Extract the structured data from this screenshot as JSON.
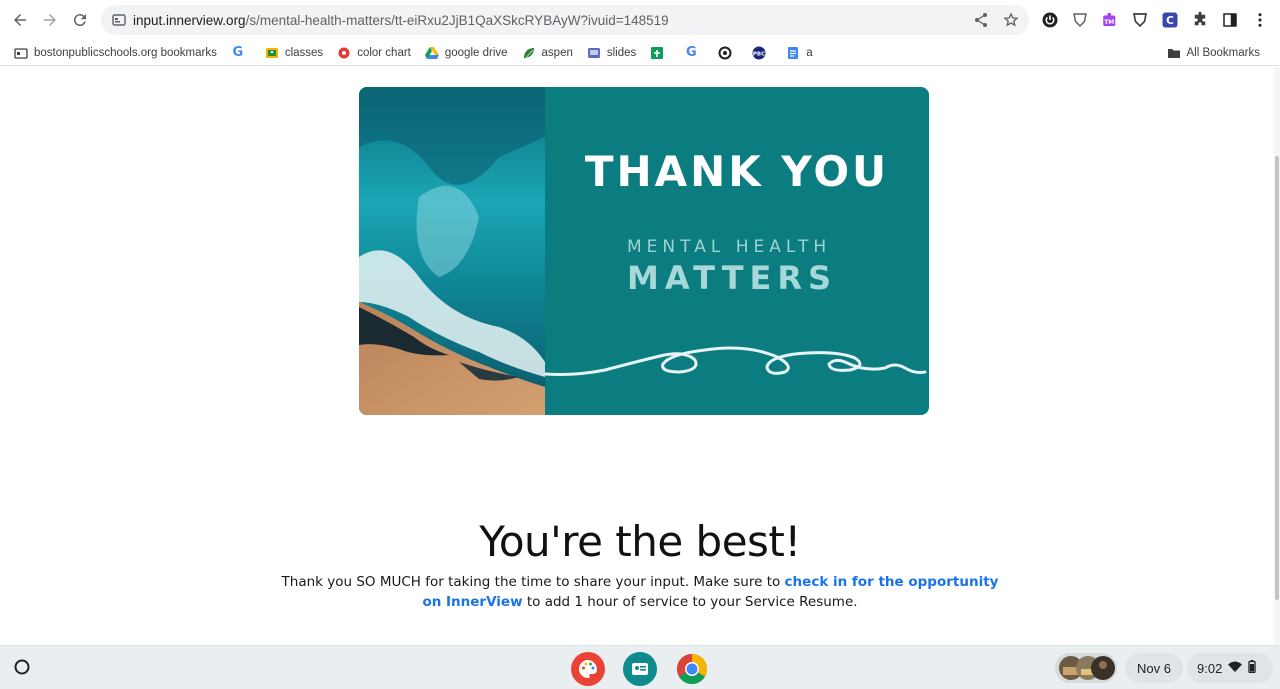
{
  "browser": {
    "url_domain": "input.innerview.org",
    "url_path": "/s/mental-health-matters/tt-eiRxu2JjB1QaXSkcRYBAyW?ivuid=148519",
    "nav_icons": [
      "back-icon",
      "forward-icon",
      "reload-icon"
    ],
    "extension_icons": [
      "power-icon",
      "shield-icon",
      "puzzle-tm-icon",
      "shield-outline-icon",
      "c-extension-icon",
      "extensions-icon",
      "side-panel-icon",
      "menu-icon"
    ]
  },
  "bookmarks": {
    "items": [
      {
        "label": "bostonpublicschools.org bookmarks",
        "icon": "folder-icon"
      },
      {
        "label": "",
        "icon": "google-icon"
      },
      {
        "label": "classes",
        "icon": "classroom-icon"
      },
      {
        "label": "color chart",
        "icon": "color-chart-icon"
      },
      {
        "label": "google drive",
        "icon": "drive-icon"
      },
      {
        "label": "aspen",
        "icon": "aspen-icon"
      },
      {
        "label": "slides",
        "icon": "slides-icon"
      },
      {
        "label": "",
        "icon": "sheets-icon"
      },
      {
        "label": "",
        "icon": "google-icon"
      },
      {
        "label": "",
        "icon": "circle-icon"
      },
      {
        "label": "",
        "icon": "pbc-icon"
      },
      {
        "label": "a",
        "icon": "docs-icon"
      }
    ],
    "all_bookmarks": "All Bookmarks"
  },
  "banner": {
    "title": "THANK YOU",
    "line1": "MENTAL  HEALTH",
    "line2": "MATTERS"
  },
  "page": {
    "headline": "You're the best!",
    "message_before": "Thank you SO MUCH for taking the time to share your input. Make sure to ",
    "message_link": "check in for the opportunity on InnerView",
    "message_after": " to add 1 hour of service to your Service Resume."
  },
  "shelf": {
    "apps": [
      "palette-app-icon",
      "classroom-app-icon",
      "chrome-app-icon"
    ],
    "date": "Nov 6",
    "time": "9:02"
  },
  "colors": {
    "banner_teal": "#0b7c80",
    "link_blue": "#1a73e8"
  }
}
